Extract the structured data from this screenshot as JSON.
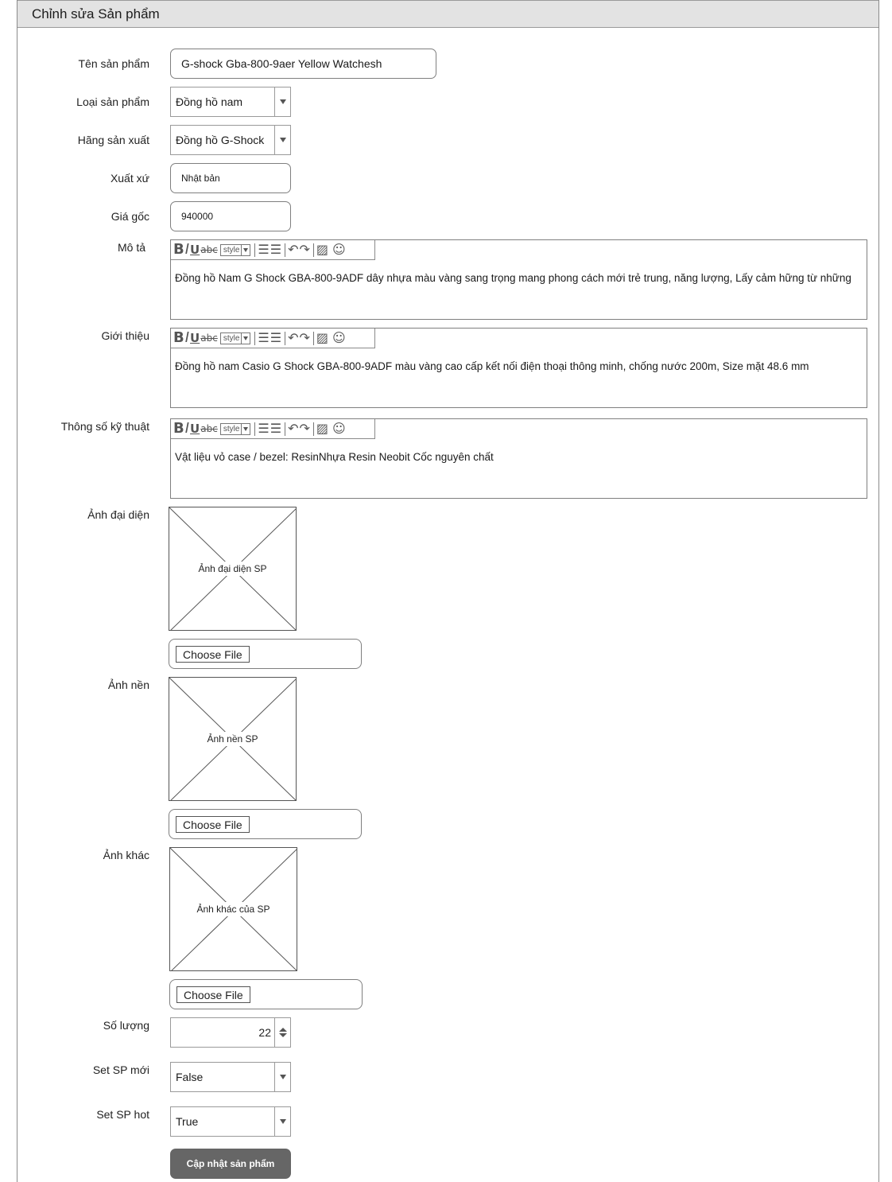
{
  "page_title": "Chỉnh sửa Sản phẩm",
  "fields": {
    "ten_san_pham": {
      "label": "Tên sản phẩm",
      "value": "G-shock Gba-800-9aer Yellow Watchesh"
    },
    "loai_san_pham": {
      "label": "Loại sản phẩm",
      "value": "Đồng hồ nam"
    },
    "hang_san_xuat": {
      "label": "Hãng sản xuất",
      "value": "Đồng hồ G-Shock"
    },
    "xuat_xu": {
      "label": "Xuất xứ",
      "value": "Nhật bản"
    },
    "gia_goc": {
      "label": "Giá gốc",
      "value": "940000"
    },
    "mo_ta": {
      "label": "Mô tả",
      "value": "Đồng hồ Nam G Shock GBA-800-9ADF dây nhựa màu vàng sang trọng mang phong cách mới trẻ trung, năng lượng, Lấy cảm hững từ những"
    },
    "gioi_thieu": {
      "label": "Giới thiệu",
      "value": "Đồng hồ nam Casio G Shock GBA-800-9ADF màu vàng cao cấp kết nối điện thoại thông minh, chống nước 200m, Size mặt  48.6 mm"
    },
    "thong_so": {
      "label": "Thông số kỹ thuật",
      "value": "Vật liệu vỏ case / bezel: ResinNhựa Resin Neobit Cốc nguyên chất"
    },
    "anh_dai_dien": {
      "label": "Ảnh đại diện",
      "placeholder": "Ảnh đại diện SP",
      "button": "Choose File"
    },
    "anh_nen": {
      "label": "Ảnh nền",
      "placeholder": "Ảnh nền SP",
      "button": "Choose File"
    },
    "anh_khac": {
      "label": "Ảnh khác",
      "placeholder": "Ảnh khác của SP",
      "button": "Choose File"
    },
    "so_luong": {
      "label": "Số lượng",
      "value": "22"
    },
    "set_sp_moi": {
      "label": "Set SP mới",
      "value": "False"
    },
    "set_sp_hot": {
      "label": "Set SP hot",
      "value": "True"
    }
  },
  "toolbar": {
    "style_label": "style",
    "bold": "B",
    "italic": "I",
    "underline": "U",
    "strike": "abc"
  },
  "submit_label": "Cập nhật sản phẩm"
}
